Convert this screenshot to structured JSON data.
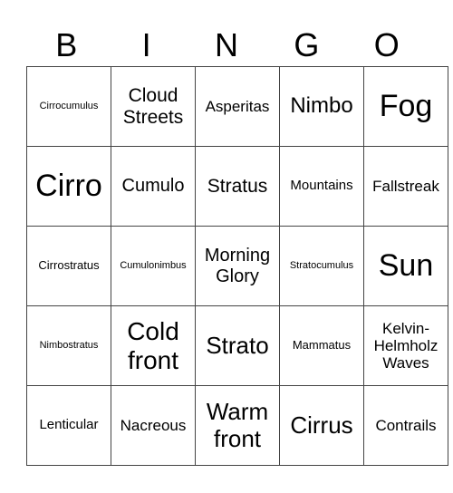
{
  "header": {
    "letters": [
      "B",
      "I",
      "N",
      "G",
      "O"
    ]
  },
  "board": {
    "rows": [
      [
        "Cirrocumulus",
        "Cloud Streets",
        "Asperitas",
        "Nimbo",
        "Fog"
      ],
      [
        "Cirro",
        "Cumulo",
        "Stratus",
        "Mountains",
        "Fallstreak"
      ],
      [
        "Cirrostratus",
        "Cumulonimbus",
        "Morning Glory",
        "Stratocumulus",
        "Sun"
      ],
      [
        "Nimbostratus",
        "Cold front",
        "Strato",
        "Mammatus",
        "Kelvin-Helmholz Waves"
      ],
      [
        "Lenticular",
        "Nacreous",
        "Warm front",
        "Cirrus",
        "Contrails"
      ]
    ]
  }
}
